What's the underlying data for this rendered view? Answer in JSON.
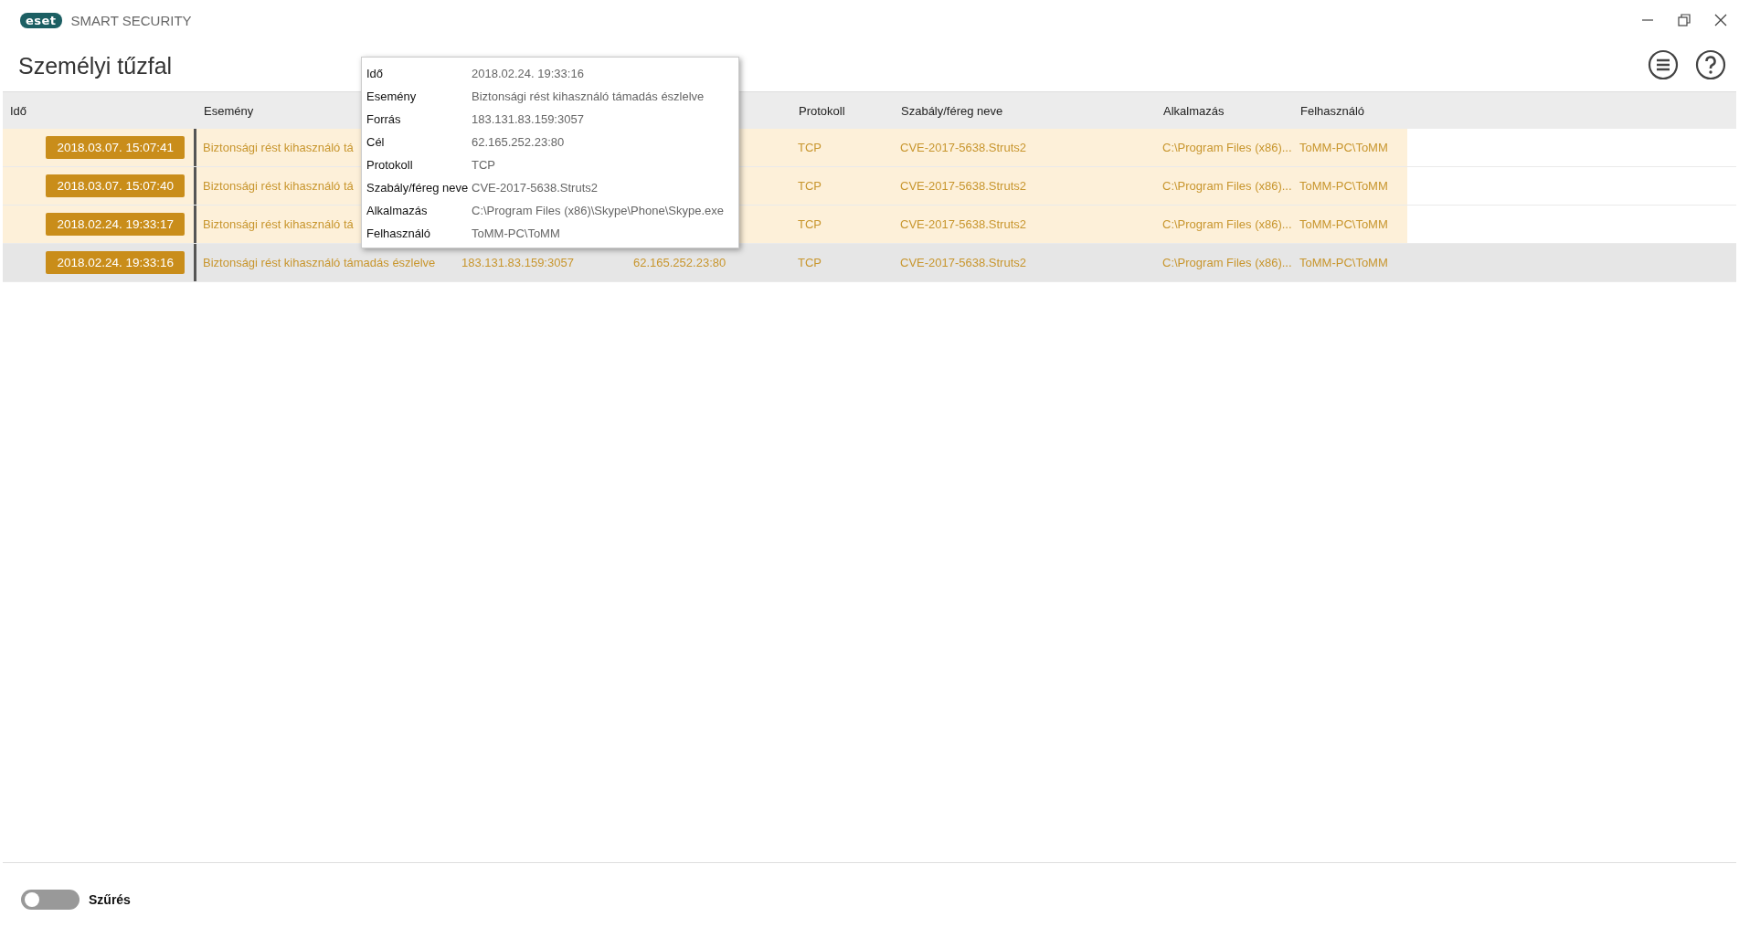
{
  "app": {
    "logo": "eset",
    "name": "SMART SECURITY"
  },
  "page": {
    "title": "Személyi tűzfal"
  },
  "table": {
    "columns": [
      "Idő",
      "Esemény",
      "Protokoll",
      "Szabály/féreg neve",
      "Alkalmazás",
      "Felhasználó"
    ],
    "rows": [
      {
        "time": "2018.03.07. 15:07:41",
        "event": "Biztonsági rést kihasználó tá",
        "protocol": "TCP",
        "rule": "CVE-2017-5638.Struts2",
        "application": "C:\\Program Files (x86)...",
        "user": "ToMM-PC\\ToMM",
        "selected": false
      },
      {
        "time": "2018.03.07. 15:07:40",
        "event": "Biztonsági rést kihasználó tá",
        "protocol": "TCP",
        "rule": "CVE-2017-5638.Struts2",
        "application": "C:\\Program Files (x86)...",
        "user": "ToMM-PC\\ToMM",
        "selected": false
      },
      {
        "time": "2018.02.24. 19:33:17",
        "event": "Biztonsági rést kihasználó tá",
        "protocol": "TCP",
        "rule": "CVE-2017-5638.Struts2",
        "application": "C:\\Program Files (x86)...",
        "user": "ToMM-PC\\ToMM",
        "selected": false
      },
      {
        "time": "2018.02.24. 19:33:16",
        "event": "Biztonsági rést kihasználó támadás észlelve",
        "source": "183.131.83.159:3057",
        "destination": "62.165.252.23:80",
        "protocol": "TCP",
        "rule": "CVE-2017-5638.Struts2",
        "application": "C:\\Program Files (x86)...",
        "user": "ToMM-PC\\ToMM",
        "selected": true
      }
    ]
  },
  "tooltip": [
    {
      "label": "Idő",
      "value": "2018.02.24. 19:33:16"
    },
    {
      "label": "Esemény",
      "value": "Biztonsági rést kihasználó támadás észlelve"
    },
    {
      "label": "Forrás",
      "value": "183.131.83.159:3057"
    },
    {
      "label": "Cél",
      "value": "62.165.252.23:80"
    },
    {
      "label": "Protokoll",
      "value": "TCP"
    },
    {
      "label": "Szabály/féreg neve",
      "value": "CVE-2017-5638.Struts2"
    },
    {
      "label": "Alkalmazás",
      "value": "C:\\Program Files (x86)\\Skype\\Phone\\Skype.exe"
    },
    {
      "label": "Felhasználó",
      "value": "ToMM-PC\\ToMM"
    }
  ],
  "filter": {
    "label": "Szűrés",
    "on": false
  }
}
